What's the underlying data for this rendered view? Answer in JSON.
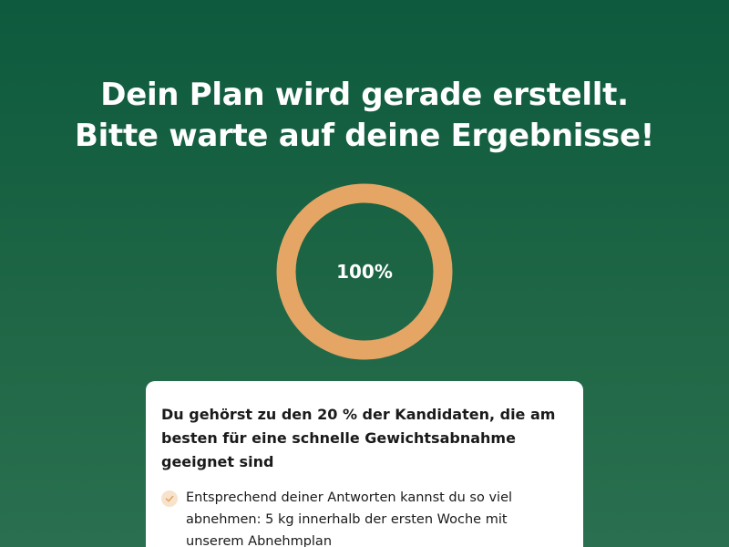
{
  "heading": {
    "line1": "Dein Plan wird gerade erstellt.",
    "line2": "Bitte warte auf deine Ergebnisse!"
  },
  "progress": {
    "value": 100,
    "label": "100%",
    "ring_color": "#e4a565"
  },
  "result_card": {
    "title": "Du gehörst zu den 20 % der Kandidaten, die am besten für eine schnelle Gewichtsabnahme geeignet sind",
    "features": [
      {
        "icon": "check-icon",
        "text": "Entsprechend deiner Antworten kannst du so viel abnehmen: 5 kg innerhalb der ersten Woche mit unserem Abnehmplan"
      }
    ]
  },
  "colors": {
    "background_top": "#0d5a3e",
    "background_bottom": "#2a7050",
    "accent": "#e4a565",
    "check_bg": "#f7e3cc"
  }
}
